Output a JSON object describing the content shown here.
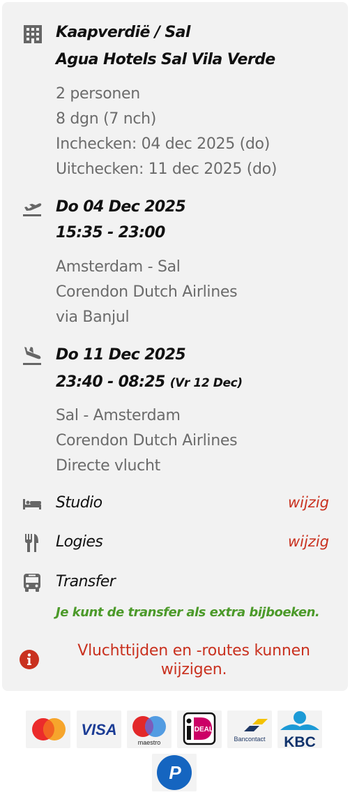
{
  "hotel": {
    "destination": "Kaapverdië / Sal",
    "name": "Agua Hotels Sal Vila Verde",
    "persons": "2 personen",
    "duration": "8 dgn (7 nch)",
    "checkin": "Inchecken: 04 dec 2025 (do)",
    "checkout": "Uitchecken: 11 dec 2025 (do)"
  },
  "outbound": {
    "date": "Do 04 Dec 2025",
    "times": "15:35 - 23:00",
    "route": "Amsterdam - Sal",
    "airline": "Corendon Dutch Airlines",
    "via": "via Banjul"
  },
  "inbound": {
    "date": "Do 11 Dec 2025",
    "times": "23:40 - 08:25",
    "arrival_note": "(Vr 12 Dec)",
    "route": "Sal - Amsterdam",
    "airline": "Corendon Dutch Airlines",
    "type": "Directe vlucht"
  },
  "room": {
    "label": "Studio",
    "change": "wijzig"
  },
  "board": {
    "label": "Logies",
    "change": "wijzig"
  },
  "transfer": {
    "label": "Transfer",
    "note": "Je kunt de transfer als extra bijboeken."
  },
  "warning": "Vluchttijden en -routes kunnen wijzigen.",
  "payment": {
    "visa": "VISA",
    "maestro": "maestro",
    "ideal": "iDEAL",
    "bancontact": "Bancontact",
    "kbc": "KBC",
    "paypal": "P"
  },
  "colors": {
    "accent_red": "#c9311f",
    "accent_green": "#4c9a2a",
    "card_bg": "#f2f2f2"
  }
}
